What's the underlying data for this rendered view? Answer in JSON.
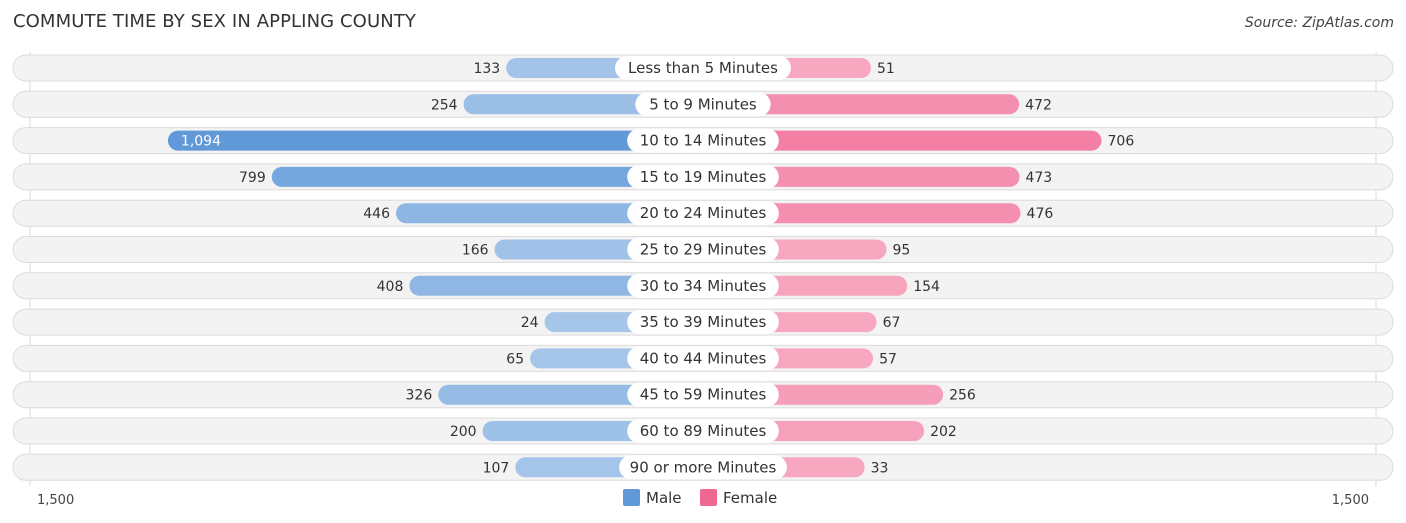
{
  "header": {
    "title": "COMMUTE TIME BY SEX IN APPLING COUNTY",
    "source": "Source: ZipAtlas.com"
  },
  "colors": {
    "male_strong": "#6199d8",
    "male_light": "#a5c5e9",
    "female_strong": "#f06792",
    "female_light": "#f7a8c0",
    "row_bg": "#f3f3f3"
  },
  "chart_data": {
    "type": "bar",
    "orientation": "horizontal-diverging",
    "title": "COMMUTE TIME BY SEX IN APPLING COUNTY",
    "categories": [
      "Less than 5 Minutes",
      "5 to 9 Minutes",
      "10 to 14 Minutes",
      "15 to 19 Minutes",
      "20 to 24 Minutes",
      "25 to 29 Minutes",
      "30 to 34 Minutes",
      "35 to 39 Minutes",
      "40 to 44 Minutes",
      "45 to 59 Minutes",
      "60 to 89 Minutes",
      "90 or more Minutes"
    ],
    "series": [
      {
        "name": "Male",
        "side": "left",
        "values": [
          133,
          254,
          1094,
          799,
          446,
          166,
          408,
          24,
          65,
          326,
          200,
          107
        ],
        "labels": [
          "133",
          "254",
          "1,094",
          "799",
          "446",
          "166",
          "408",
          "24",
          "65",
          "326",
          "200",
          "107"
        ]
      },
      {
        "name": "Female",
        "side": "right",
        "values": [
          51,
          472,
          706,
          473,
          476,
          95,
          154,
          67,
          57,
          256,
          202,
          33
        ],
        "labels": [
          "51",
          "472",
          "706",
          "473",
          "476",
          "95",
          "154",
          "67",
          "57",
          "256",
          "202",
          "33"
        ]
      }
    ],
    "axis": {
      "left_label": "1,500",
      "right_label": "1,500",
      "max": 1500
    },
    "legend": {
      "position": "bottom-center",
      "items": [
        "Male",
        "Female"
      ]
    },
    "grid": false
  }
}
